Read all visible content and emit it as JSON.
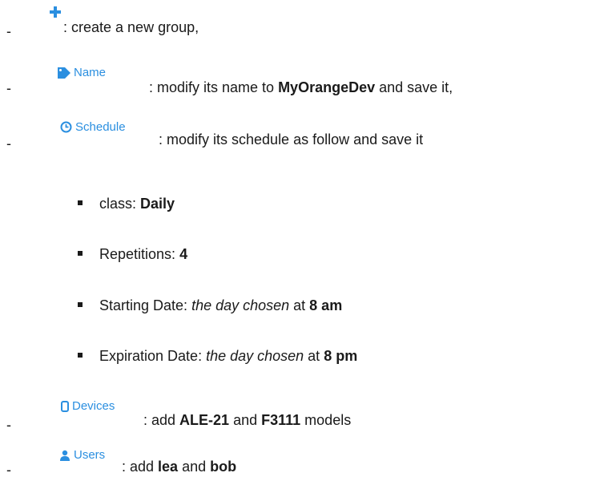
{
  "items": [
    {
      "dash": "-",
      "icon": "plus-icon",
      "button_label": "",
      "text": ": create a new group,"
    },
    {
      "dash": "-",
      "icon": "tag-icon",
      "button_label": "Name",
      "text_pre": ": modify its name to ",
      "text_bold": "MyOrangeDev",
      "text_post": " and save it,"
    },
    {
      "dash": "-",
      "icon": "clock-icon",
      "button_label": "Schedule",
      "text": ": modify its schedule as follow and save it",
      "subitems": [
        {
          "pre": "class: ",
          "bold": "Daily"
        },
        {
          "pre": "Repetitions: ",
          "bold": "4"
        },
        {
          "pre": "Starting Date: ",
          "italic": "the day chosen",
          "mid": " at ",
          "bold": "8 am"
        },
        {
          "pre": "Expiration Date: ",
          "italic": "the day chosen",
          "mid": " at ",
          "bold": "8 pm"
        }
      ]
    },
    {
      "dash": "-",
      "icon": "device-icon",
      "button_label": "Devices",
      "text_pre": ": add ",
      "text_bold1": "ALE-21",
      "text_mid": " and ",
      "text_bold2": "F3111",
      "text_post": " models"
    },
    {
      "dash": "-",
      "icon": "user-icon",
      "button_label": "Users",
      "text_pre": ": add ",
      "text_bold1": "lea",
      "text_mid": " and ",
      "text_bold2": "bob"
    }
  ],
  "colors": {
    "accent": "#2b8fe0",
    "text": "#1a1a1a"
  }
}
